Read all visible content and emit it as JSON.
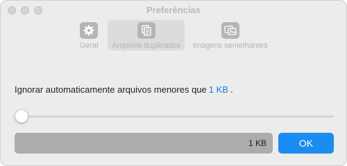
{
  "window": {
    "title": "Preferências"
  },
  "toolbar": {
    "tabs": [
      {
        "label": "Geral",
        "icon": "gear-icon",
        "selected": false
      },
      {
        "label": "Arquivos duplicados",
        "icon": "duplicate-files-icon",
        "selected": true
      },
      {
        "label": "Imagens semelhantes",
        "icon": "similar-images-icon",
        "selected": false
      }
    ]
  },
  "settings": {
    "description_prefix": "Ignorar automaticamente arquivos menores que",
    "size_value": "1 KB",
    "description_suffix": ".",
    "slider_fraction": 0,
    "size_display": "1 KB"
  },
  "buttons": {
    "ok_label": "OK"
  },
  "colors": {
    "accent": "#1b8cf0",
    "link_value": "#1a7fe0",
    "window_bg": "#ececec"
  }
}
